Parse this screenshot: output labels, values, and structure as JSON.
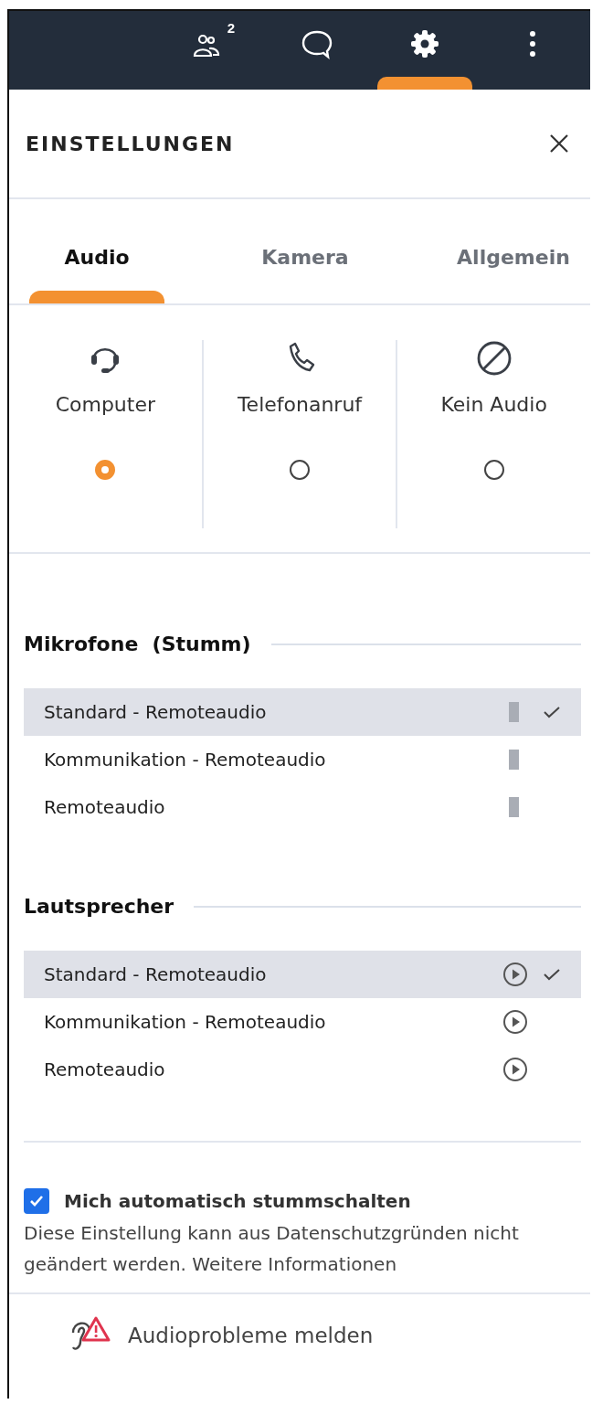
{
  "top_bar": {
    "items": [
      {
        "kind": "participants",
        "badge": "2",
        "selected": false
      },
      {
        "kind": "chat",
        "selected": false
      },
      {
        "kind": "settings",
        "selected": true
      },
      {
        "kind": "more",
        "selected": false
      }
    ]
  },
  "panel": {
    "title": "EINSTELLUNGEN"
  },
  "tabs": [
    {
      "label": "Audio",
      "selected": true
    },
    {
      "label": "Kamera",
      "selected": false
    },
    {
      "label": "Allgemein",
      "selected": false
    }
  ],
  "audio_options": [
    {
      "kind": "headset",
      "label": "Computer",
      "selected": true
    },
    {
      "kind": "phone",
      "label": "Telefonanruf",
      "selected": false
    },
    {
      "kind": "none",
      "label": "Kein Audio",
      "selected": false
    }
  ],
  "microphones": {
    "title": "Mikrofone",
    "note": "(Stumm)",
    "items": [
      {
        "name": "Standard - Remoteaudio",
        "selected": true
      },
      {
        "name": "Kommunikation - Remoteaudio",
        "selected": false
      },
      {
        "name": "Remoteaudio",
        "selected": false
      }
    ]
  },
  "speakers": {
    "title": "Lautsprecher",
    "items": [
      {
        "name": "Standard - Remoteaudio",
        "selected": true
      },
      {
        "name": "Kommunikation - Remoteaudio",
        "selected": false
      },
      {
        "name": "Remoteaudio",
        "selected": false
      }
    ]
  },
  "auto_mute": {
    "label": "Mich automatisch stummschalten",
    "checked": true,
    "description": "Diese Einstellung kann aus Datenschutzgründen nicht geändert werden. Weitere Informationen"
  },
  "report": {
    "label": "Audioprobleme melden"
  }
}
